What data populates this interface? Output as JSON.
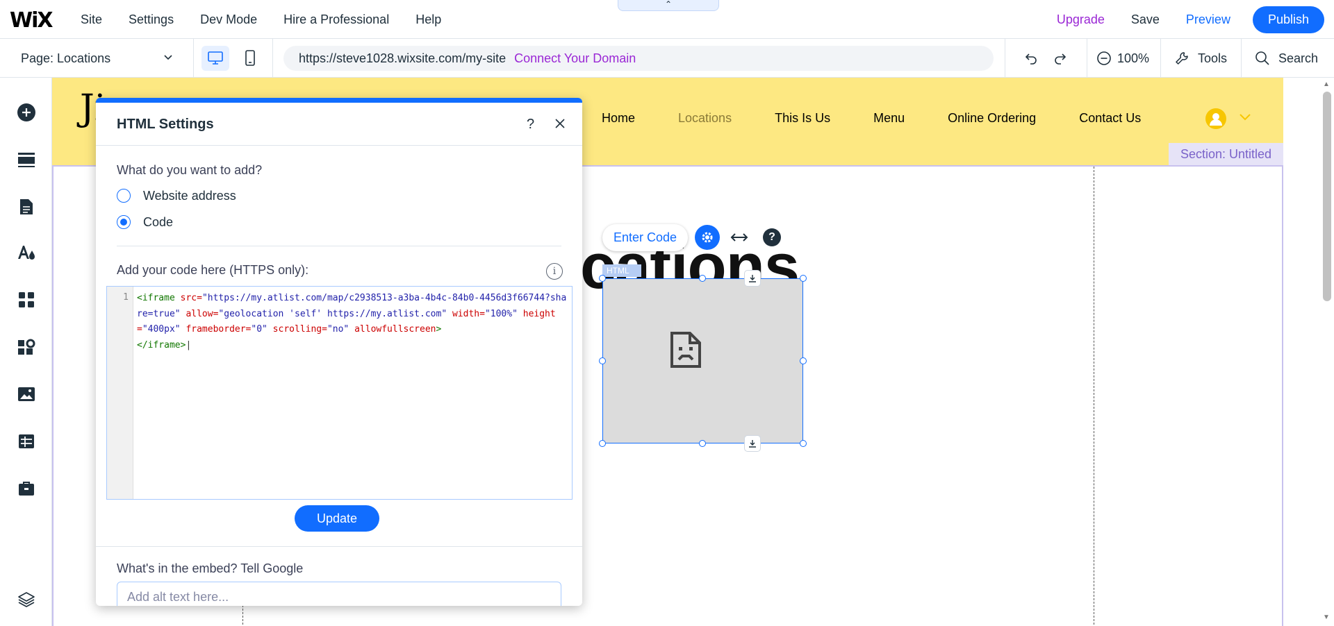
{
  "topbar": {
    "logo": "WiX",
    "menu": [
      "Site",
      "Settings",
      "Dev Mode",
      "Hire a Professional",
      "Help"
    ],
    "handle": "⌃",
    "upgrade": "Upgrade",
    "save": "Save",
    "preview": "Preview",
    "publish": "Publish"
  },
  "toolbar": {
    "page": "Page: Locations",
    "url": "https://steve1028.wixsite.com/my-site",
    "connect_domain": "Connect Your Domain",
    "zoom": "100%",
    "tools": "Tools",
    "search": "Search"
  },
  "site": {
    "logo_fragment": "Ji",
    "nav": [
      "Home",
      "Locations",
      "This Is Us",
      "Menu",
      "Online Ordering",
      "Contact Us"
    ],
    "active_nav": "Locations",
    "section_label": "Section: Untitled",
    "title_fragment": "cations",
    "html_tag": "HTML"
  },
  "floating_toolbar": {
    "enter_code": "Enter Code"
  },
  "dialog": {
    "title": "HTML Settings",
    "question": "What do you want to add?",
    "option_website": "Website address",
    "option_code": "Code",
    "selected": "Code",
    "code_label": "Add your code here (HTTPS only):",
    "line_number": "1",
    "code": {
      "t1": "<iframe ",
      "a1": "src=",
      "s1": "\"https://my.atlist.com/map/c2938513-a3ba-4b4c-84b0-4456d3f66744?share=true\"",
      "a2": " allow=",
      "s2": "\"geolocation 'self' https://my.atlist.com\"",
      "a3": " width=",
      "s3": "\"100%\"",
      "a4": " height=",
      "s4": "\"400px\"",
      "a5": " frameborder=",
      "s5": "\"0\"",
      "a6": " scrolling=",
      "s6": "\"no\"",
      "a7": " allowfullscreen",
      "t2": ">",
      "t3": "</iframe>"
    },
    "update": "Update",
    "embed_label": "What's in the embed? Tell Google",
    "alt_placeholder": "Add alt text here..."
  },
  "colors": {
    "accent": "#116dff",
    "upgrade": "#9a27d5",
    "site_header": "#fde882",
    "section_label_bg": "#e6e3f7"
  }
}
